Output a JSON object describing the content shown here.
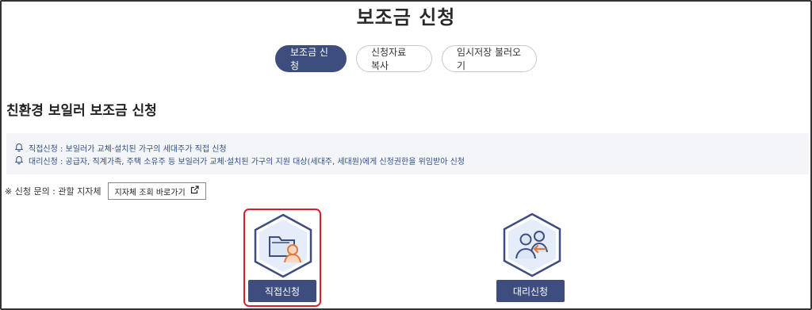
{
  "page": {
    "title": "보조금 신청"
  },
  "tabs": [
    {
      "label": "보조금 신청",
      "active": true
    },
    {
      "label": "신청자료 복사",
      "active": false
    },
    {
      "label": "임시저장 불러오기",
      "active": false
    }
  ],
  "section": {
    "title": "친환경 보일러 보조금 신청"
  },
  "info": {
    "lines": [
      "직접신청 : 보일러가 교체·설치된 가구의 세대주가 직접 신청",
      "대리신청 : 공급자, 직계가족, 주택 소유주 등 보일러가 교체·설치된 가구의 지원 대상(세대주, 세대원)에게 신청권한을 위임받아 신청"
    ],
    "icon": "bell-icon"
  },
  "inquiry": {
    "text": "※ 신청 문의 : 관할 지자체",
    "button_label": "지자체 조회 바로가기",
    "button_icon": "external-link-icon"
  },
  "options": [
    {
      "label": "직접신청",
      "icon": "folder-user-icon",
      "selected": true
    },
    {
      "label": "대리신청",
      "icon": "users-delegate-icon",
      "selected": false
    }
  ],
  "colors": {
    "primary": "#3d4d7e",
    "highlight": "#d4202a",
    "info_text": "#2f4f86",
    "accent": "#f0a05a"
  }
}
